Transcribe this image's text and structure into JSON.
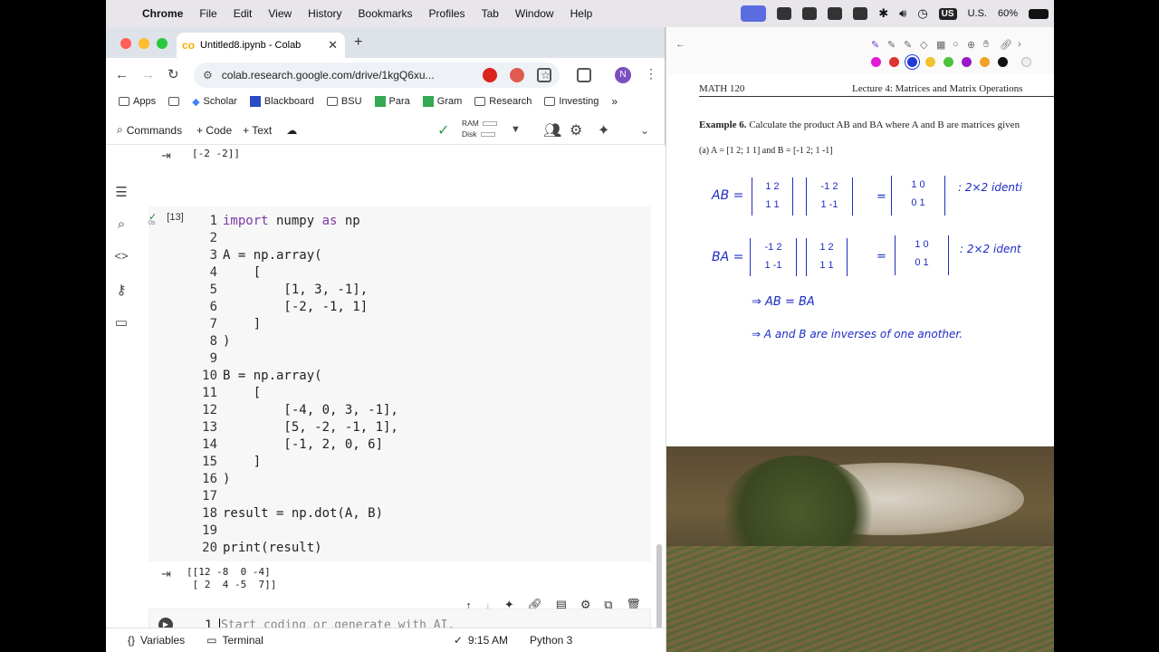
{
  "menubar": {
    "app": "Chrome",
    "items": [
      "File",
      "Edit",
      "View",
      "History",
      "Bookmarks",
      "Profiles",
      "Tab",
      "Window",
      "Help"
    ],
    "input_source": "U.S.",
    "input_badge": "US",
    "battery": "60%"
  },
  "browser": {
    "tab_title": "Untitled8.ipynb - Colab",
    "url": "colab.research.google.com/drive/1kgQ6xu...",
    "avatar_initial": "N",
    "bookmarks": [
      "Apps",
      "Scholar",
      "Blackboard",
      "BSU",
      "Para",
      "Gram",
      "Research",
      "Investing"
    ]
  },
  "colab": {
    "commands": "Commands",
    "add_code": "+ Code",
    "add_text": "+ Text",
    "ram_label": "RAM",
    "disk_label": "Disk",
    "prev_output": "[-2 -2]]",
    "cell_exec": "[13]",
    "cell_time": "0s",
    "code_lines": [
      {
        "n": "1",
        "parts": [
          {
            "k": "kw",
            "t": "import"
          },
          {
            "k": "tx",
            "t": " numpy "
          },
          {
            "k": "kw",
            "t": "as"
          },
          {
            "k": "tx",
            "t": " np"
          }
        ]
      },
      {
        "n": "2",
        "parts": []
      },
      {
        "n": "3",
        "parts": [
          {
            "k": "tx",
            "t": "A = np.array("
          }
        ]
      },
      {
        "n": "4",
        "parts": [
          {
            "k": "tx",
            "t": "    ["
          }
        ]
      },
      {
        "n": "5",
        "parts": [
          {
            "k": "tx",
            "t": "        [1, 3, -1],"
          }
        ]
      },
      {
        "n": "6",
        "parts": [
          {
            "k": "tx",
            "t": "        [-2, -1, 1]"
          }
        ]
      },
      {
        "n": "7",
        "parts": [
          {
            "k": "tx",
            "t": "    ]"
          }
        ]
      },
      {
        "n": "8",
        "parts": [
          {
            "k": "tx",
            "t": ")"
          }
        ]
      },
      {
        "n": "9",
        "parts": []
      },
      {
        "n": "10",
        "parts": [
          {
            "k": "tx",
            "t": "B = np.array("
          }
        ]
      },
      {
        "n": "11",
        "parts": [
          {
            "k": "tx",
            "t": "    ["
          }
        ]
      },
      {
        "n": "12",
        "parts": [
          {
            "k": "tx",
            "t": "        [-4, 0, 3, -1],"
          }
        ]
      },
      {
        "n": "13",
        "parts": [
          {
            "k": "tx",
            "t": "        [5, -2, -1, 1],"
          }
        ]
      },
      {
        "n": "14",
        "parts": [
          {
            "k": "tx",
            "t": "        [-1, 2, 0, 6]"
          }
        ]
      },
      {
        "n": "15",
        "parts": [
          {
            "k": "tx",
            "t": "    ]"
          }
        ]
      },
      {
        "n": "16",
        "parts": [
          {
            "k": "tx",
            "t": ")"
          }
        ]
      },
      {
        "n": "17",
        "parts": []
      },
      {
        "n": "18",
        "parts": [
          {
            "k": "tx",
            "t": "result = np.dot(A, B)"
          }
        ]
      },
      {
        "n": "19",
        "parts": []
      },
      {
        "n": "20",
        "parts": [
          {
            "k": "tx",
            "t": "print(result)"
          }
        ]
      }
    ],
    "output_line1": "[[12 -8  0 -4]",
    "output_line2": " [ 2  4 -5  7]]",
    "new_cell_line": "1",
    "new_cell_placeholder": "Start coding or generate with AI.",
    "status_variables": "Variables",
    "status_terminal": "Terminal",
    "status_time": "9:15 AM",
    "status_runtime": "Python 3"
  },
  "pdf": {
    "header_left": "MATH 120",
    "header_right": "Lecture 4: Matrices and Matrix Operations",
    "example_label": "Example 6.",
    "example_text": "Calculate the product AB and BA where A and B are matrices given",
    "part_a": "(a)  A = [1 2; 1 1] and B = [-1 2; 1 -1]",
    "hw_ab": "AB =",
    "hw_ab_note": ":  2×2 identi",
    "hw_ba": "BA =",
    "hw_ba_note": ":  2×2 ident",
    "hw_conclude1": "⇒  AB = BA",
    "hw_conclude2": "⇒  A and B are inverses of one another."
  }
}
